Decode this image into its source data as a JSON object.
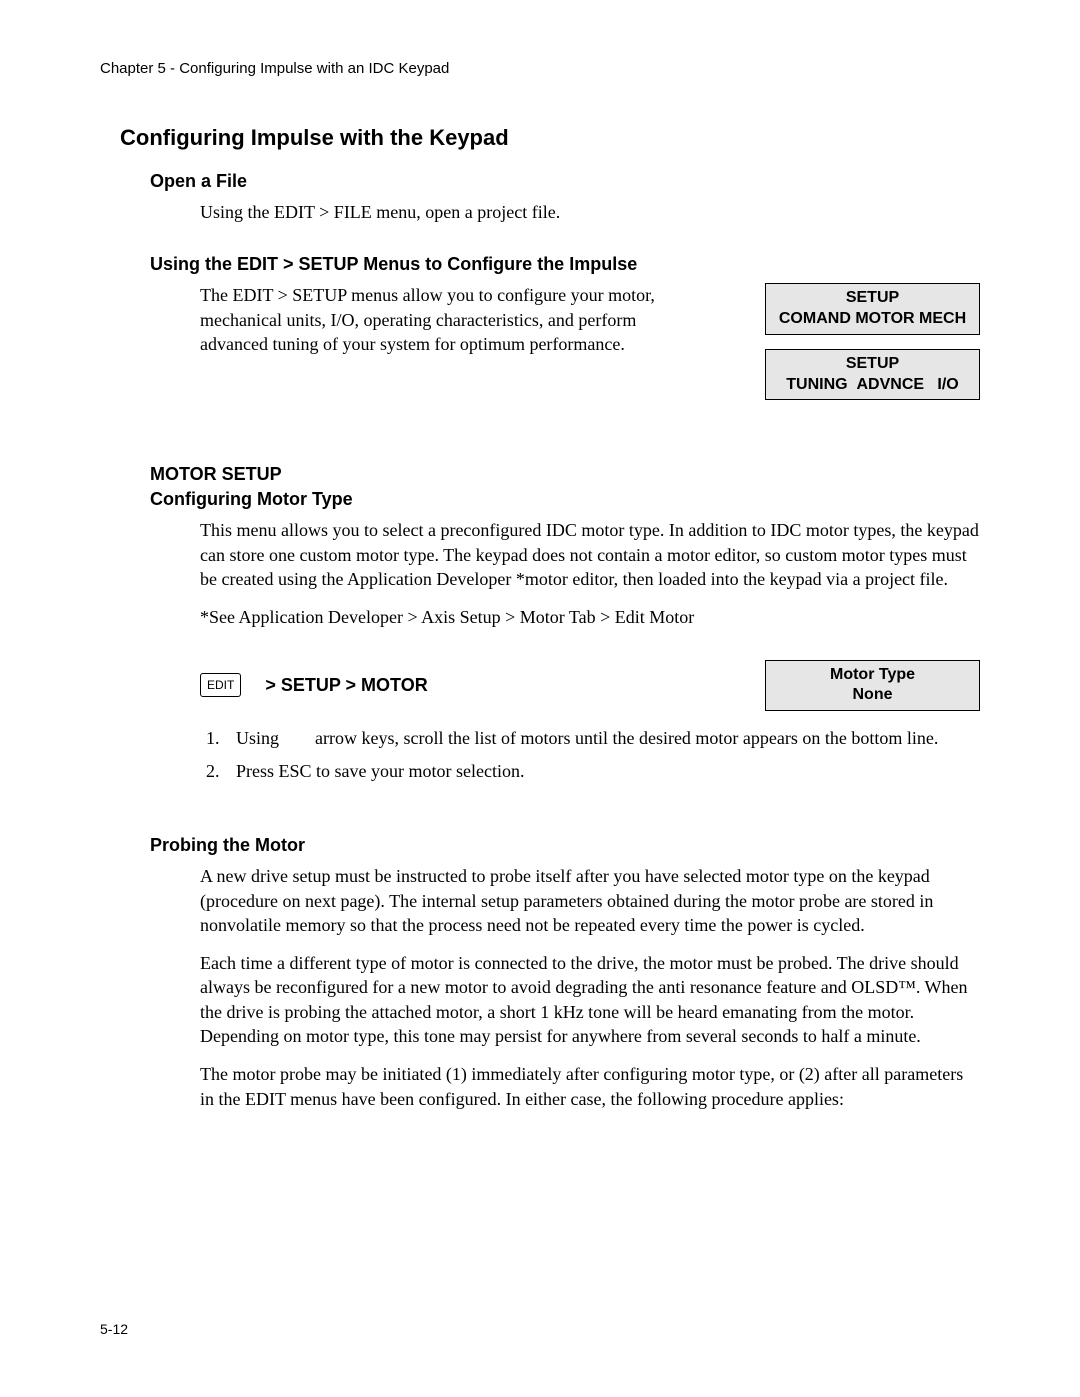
{
  "header": "Chapter 5 - Configuring Impulse with an IDC Keypad",
  "title": "Configuring Impulse with the Keypad",
  "open_file": {
    "heading": "Open a File",
    "body": "Using the EDIT > FILE menu, open a project file."
  },
  "setup_menus": {
    "heading": "Using the EDIT > SETUP Menus to Configure the Impulse",
    "body": "The EDIT > SETUP menus allow you to configure your motor, mechanical units, I/O, operating characteristics, and perform advanced tuning of your system for optimum performance.",
    "lcd1_line1": "SETUP",
    "lcd1_line2": "COMAND MOTOR MECH",
    "lcd2_line1": "SETUP",
    "lcd2_line2": "TUNING  ADVNCE   I/O"
  },
  "motor_setup": {
    "heading": "MOTOR SETUP",
    "config_heading": "Configuring Motor Type",
    "para1": "This menu allows you to select a preconfigured IDC motor type. In addition to IDC motor types, the keypad can store one custom motor type. The keypad does not contain a motor editor, so custom motor types must be created using the Application Developer *motor editor, then loaded into the keypad via a project file.",
    "para2": "*See Application Developer > Axis Setup > Motor Tab > Edit Motor",
    "edit_key": "EDIT",
    "nav_path": ">  SETUP > MOTOR",
    "lcd_line1": "Motor Type",
    "lcd_line2": "None",
    "steps": [
      "Using        arrow keys, scroll the list of motors until the desired motor appears on the bottom line.",
      "Press ESC to save your motor selection."
    ]
  },
  "probing": {
    "heading": "Probing the Motor",
    "para1": "A new drive setup must be instructed to probe itself after you have selected motor type on the keypad (procedure on next page). The internal setup parameters obtained during the motor probe are stored in nonvolatile memory so that the process need not be repeated every time the power is cycled.",
    "para2": "Each time a different type of motor is connected to the drive, the motor must be probed. The drive should always be reconfigured for a new motor to avoid degrading the anti resonance feature and OLSD™. When the drive is probing the attached motor, a short 1 kHz tone will be heard emanating from the motor. Depending on motor type, this tone may persist for anywhere from several seconds to half a minute.",
    "para3": "The motor probe may be initiated (1) immediately after configuring motor type, or (2) after all parameters in the EDIT menus have been configured. In either case, the following procedure applies:"
  },
  "page_number": "5-12"
}
